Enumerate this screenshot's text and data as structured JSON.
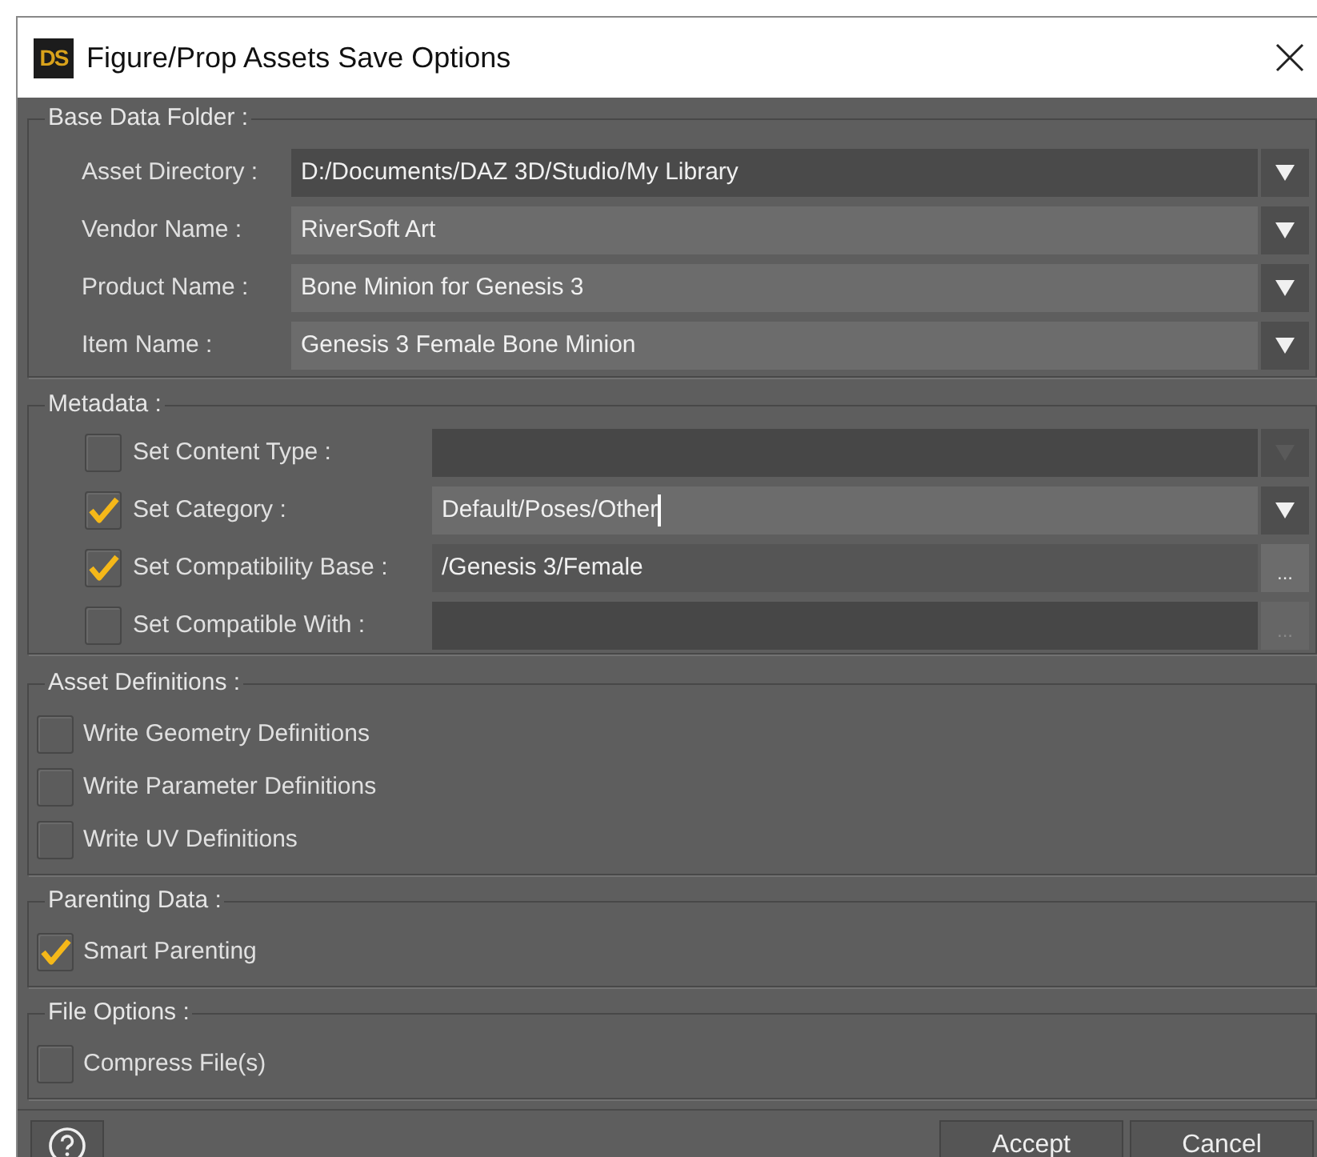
{
  "window": {
    "title": "Figure/Prop Assets Save Options",
    "logo": "DS"
  },
  "base_data_folder": {
    "title": "Base Data Folder :",
    "fields": [
      {
        "label": "Asset Directory :",
        "value": "D:/Documents/DAZ 3D/Studio/My Library",
        "editable": false
      },
      {
        "label": "Vendor Name :",
        "value": "RiverSoft Art",
        "editable": true
      },
      {
        "label": "Product Name :",
        "value": "Bone Minion for Genesis 3",
        "editable": true
      },
      {
        "label": "Item Name :",
        "value": "Genesis 3 Female Bone Minion",
        "editable": true
      }
    ]
  },
  "metadata": {
    "title": "Metadata :",
    "rows": [
      {
        "label": "Set Content Type :",
        "checked": false,
        "value": "",
        "kind": "dropdown",
        "focused": false
      },
      {
        "label": "Set Category :",
        "checked": true,
        "value": "Default/Poses/Other",
        "kind": "dropdown",
        "focused": true
      },
      {
        "label": "Set Compatibility Base :",
        "checked": true,
        "value": "/Genesis 3/Female",
        "kind": "browse",
        "browse_label": "...",
        "focused": false
      },
      {
        "label": "Set Compatible With :",
        "checked": false,
        "value": "",
        "kind": "browse",
        "browse_label": "...",
        "focused": false
      }
    ]
  },
  "groups": [
    {
      "title": "Asset Definitions :",
      "options": [
        {
          "label": "Write Geometry Definitions",
          "checked": false
        },
        {
          "label": "Write Parameter Definitions",
          "checked": false
        },
        {
          "label": "Write UV Definitions",
          "checked": false
        }
      ]
    },
    {
      "title": "Parenting Data :",
      "options": [
        {
          "label": "Smart Parenting",
          "checked": true
        }
      ]
    },
    {
      "title": "File Options :",
      "options": [
        {
          "label": "Compress File(s)",
          "checked": false
        }
      ]
    }
  ],
  "buttons": [
    "Accept",
    "Cancel"
  ]
}
